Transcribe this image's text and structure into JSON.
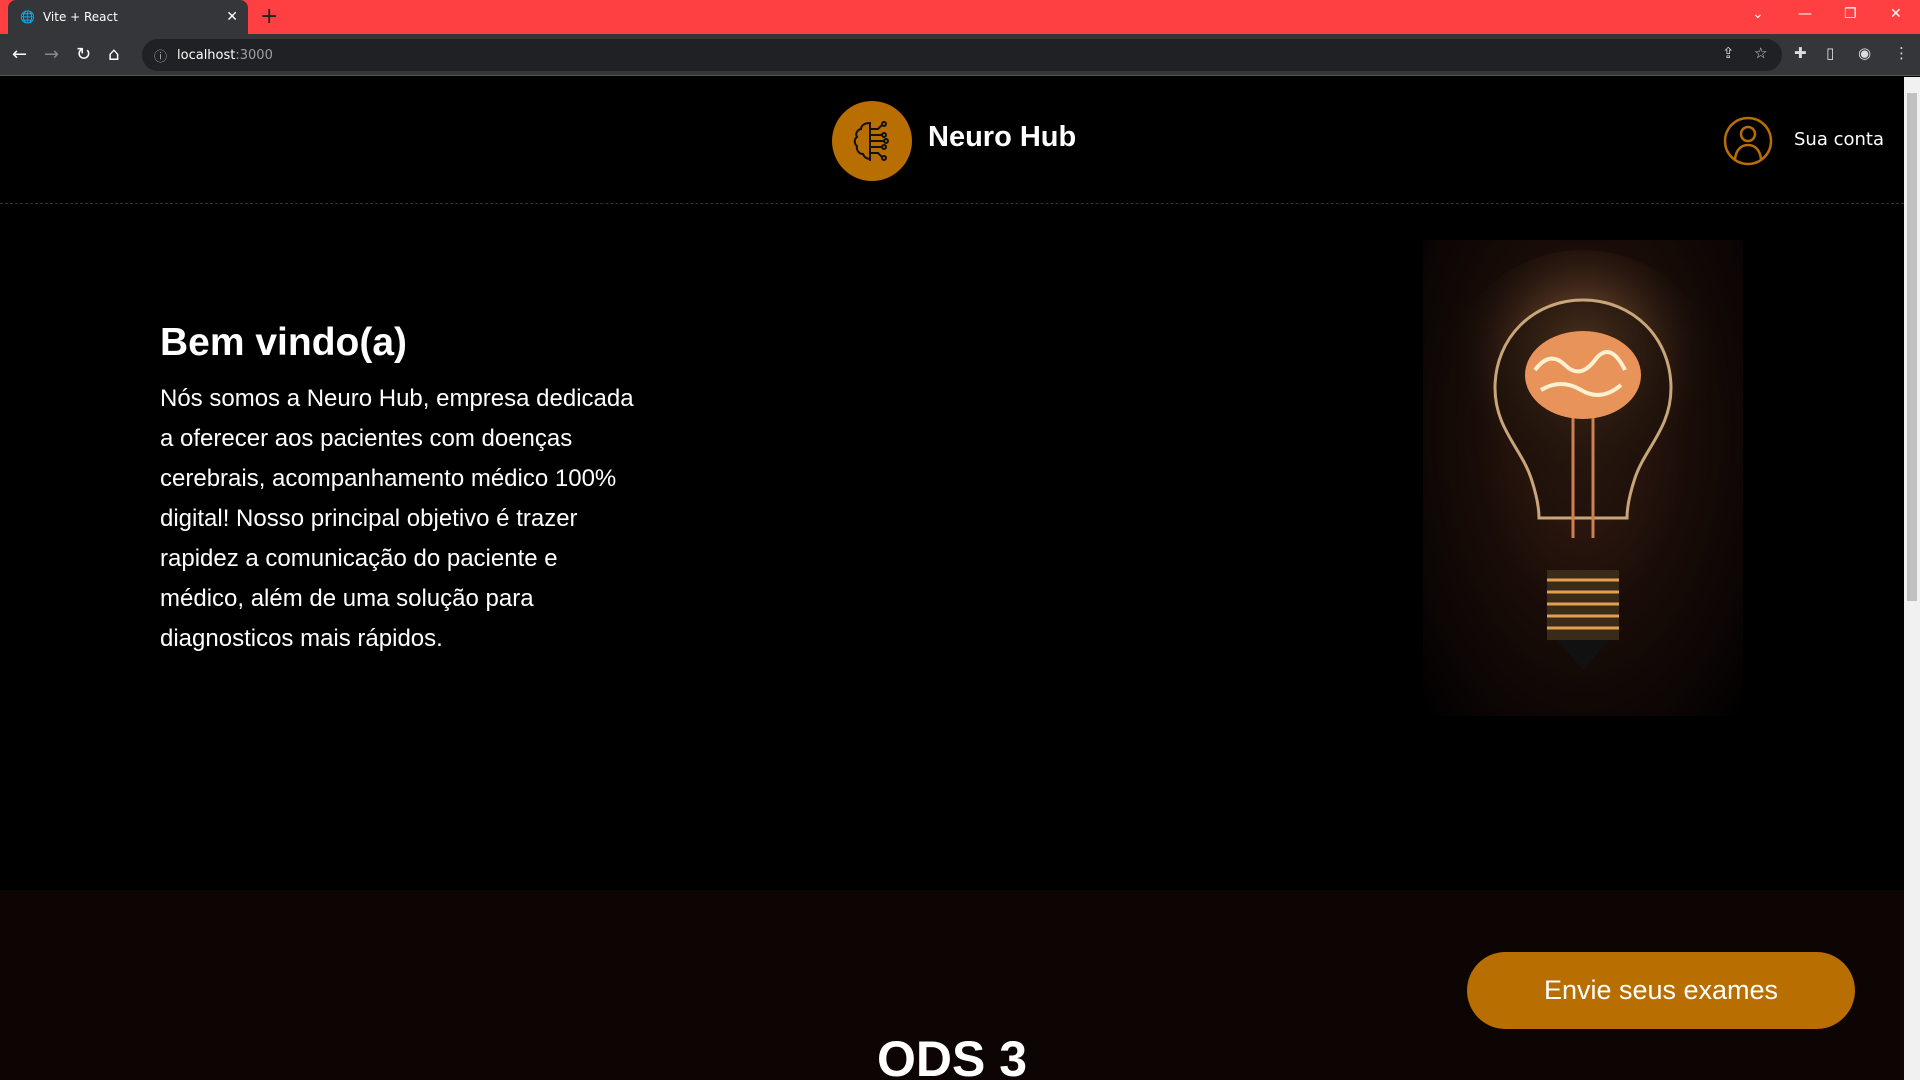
{
  "browser": {
    "tab_title": "Vite + React",
    "url_host": "localhost",
    "url_port": ":3000"
  },
  "header": {
    "brand": "Neuro Hub",
    "account_label": "Sua conta"
  },
  "hero": {
    "title": "Bem vindo(a)",
    "text": "Nós somos a Neuro Hub, empresa dedicada a oferecer aos pacientes com doenças cerebrais, acompanhamento médico 100% digital! Nosso principal objetivo é trazer rapidez a comunicação do paciente e médico, além de uma solução para diagnosticos mais rápidos."
  },
  "section2": {
    "cta_label": "Envie seus exames",
    "heading": "ODS 3"
  },
  "colors": {
    "accent": "#b86e00",
    "tabbar": "#ff4043",
    "section_bg": "#0d0503"
  }
}
